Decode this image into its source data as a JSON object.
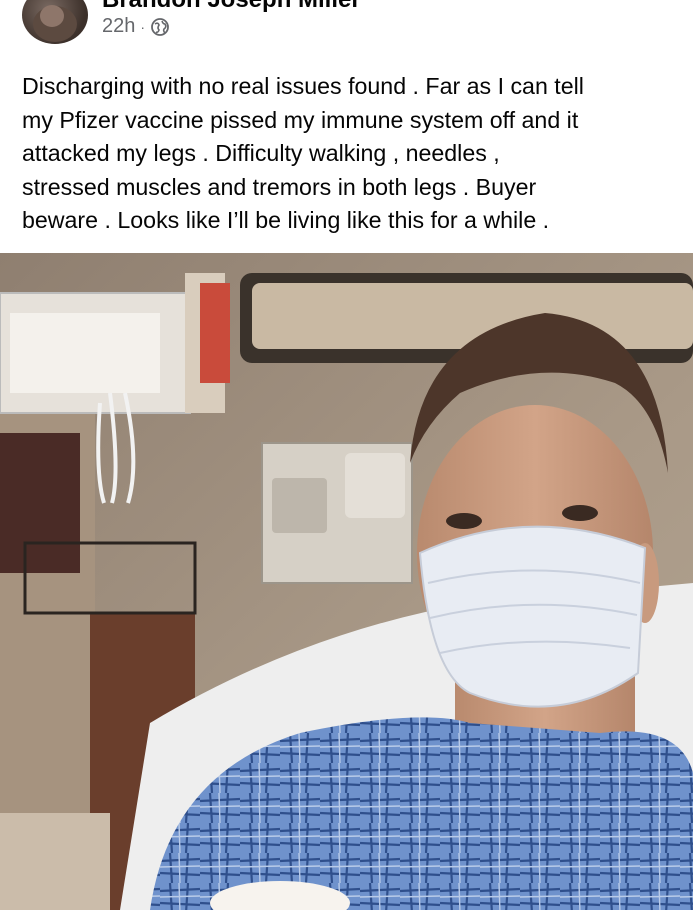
{
  "post": {
    "author_name": "Brandon Joseph Miller",
    "time": "22h",
    "separator": "·",
    "audience_icon": "globe-icon",
    "text_lines": [
      "Discharging with no real issues found . Far as I can tell",
      "my Pfizer vaccine pissed my immune system off and it",
      "attacked my legs . Difficulty walking , needles ,",
      "stressed muscles and tremors in both legs . Buyer",
      "beware . Looks like I’ll be living like this for a while ."
    ]
  },
  "photo": {
    "icon": "photo",
    "colors": {
      "wall": "#9c8c7c",
      "mask": "#e8ecf3",
      "gown": "#5f86c4"
    }
  }
}
